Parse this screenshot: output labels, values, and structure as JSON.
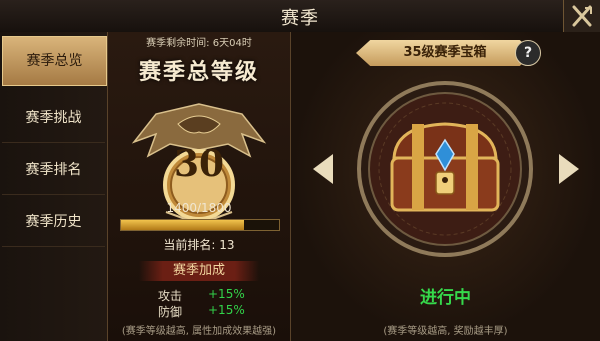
{
  "window": {
    "title": "赛季"
  },
  "sidebar": {
    "items": [
      {
        "label": "赛季总览",
        "active": true
      },
      {
        "label": "赛季挑战",
        "active": false
      },
      {
        "label": "赛季排名",
        "active": false
      },
      {
        "label": "赛季历史",
        "active": false
      }
    ]
  },
  "season": {
    "remaining_label": "赛季剩余时间:",
    "remaining_value": "6天04时",
    "level_title": "赛季总等级",
    "level": "30",
    "exp_text": "1400/1800",
    "exp_progress": 0.78,
    "rank_label": "当前排名:",
    "rank_value": "13",
    "bonus_title": "赛季加成",
    "bonuses": [
      {
        "label": "攻击",
        "value": "+15%"
      },
      {
        "label": "防御",
        "value": "+15%"
      }
    ],
    "footnote": "(赛季等级越高, 属性加成效果越强)"
  },
  "reward": {
    "title": "35级赛季宝箱",
    "help_glyph": "?",
    "status": "进行中",
    "footnote": "(赛季等级越高, 奖励越丰厚)"
  },
  "colors": {
    "accent_gold": "#d9b47a",
    "status_green": "#36d94b",
    "bar_gold": "#f1c34d"
  },
  "icons": {
    "close": "close-icon",
    "prev": "arrow-left-icon",
    "next": "arrow-right-icon",
    "chest": "treasure-chest-icon",
    "emblem": "winged-emblem-icon"
  }
}
